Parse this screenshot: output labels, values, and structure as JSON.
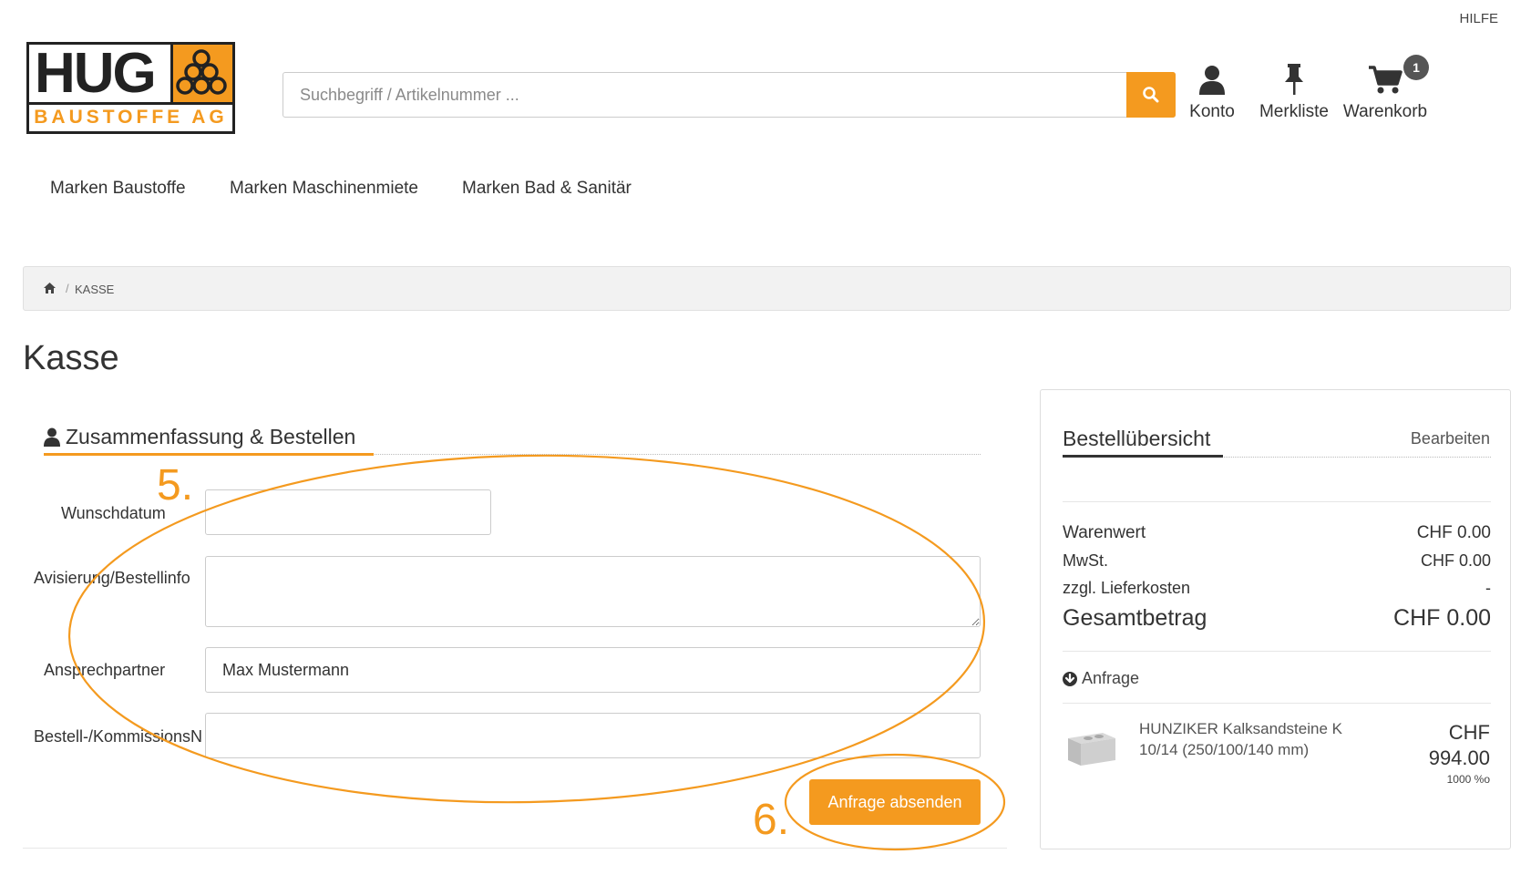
{
  "header": {
    "help_link": "HILFE",
    "logo": {
      "brand": "HUG",
      "subtitle": "BAUSTOFFE AG"
    },
    "search": {
      "placeholder": "Suchbegriff / Artikelnummer ..."
    },
    "account_label": "Konto",
    "wishlist_label": "Merkliste",
    "cart_label": "Warenkorb",
    "cart_count": "1"
  },
  "nav": {
    "items": [
      "Marken Baustoffe",
      "Marken Maschinenmiete",
      "Marken Bad & Sanitär"
    ]
  },
  "breadcrumb": {
    "current": "KASSE",
    "separator": "/"
  },
  "page_title": "Kasse",
  "checkout": {
    "section_title": "Zusammenfassung & Bestellen",
    "fields": {
      "date_label": "Wunschdatum",
      "date_value": "",
      "info_label": "Avisierung/Bestellinfo",
      "info_value": "",
      "contact_label": "Ansprechpartner",
      "contact_value": "Max Mustermann",
      "commission_label": "Bestell-/KommissionsN",
      "commission_value": ""
    },
    "submit_label": "Anfrage absenden",
    "annotation_step_5": "5.",
    "annotation_step_6": "6."
  },
  "summary": {
    "title": "Bestellübersicht",
    "edit_link": "Bearbeiten",
    "goods_label": "Warenwert",
    "goods_value": "CHF 0.00",
    "tax_label": "MwSt.",
    "tax_value": "CHF 0.00",
    "delivery_label": "zzgl. Lieferkosten",
    "delivery_value": "-",
    "total_label": "Gesamtbetrag",
    "total_value": "CHF 0.00",
    "request_label": "Anfrage",
    "product": {
      "name": "HUNZIKER Kalksandsteine K 10/14 (250/100/140 mm)",
      "currency": "CHF",
      "price": "994.00",
      "unit": "1000 %o"
    }
  },
  "colors": {
    "accent": "#f49a1f",
    "text": "#333333"
  }
}
